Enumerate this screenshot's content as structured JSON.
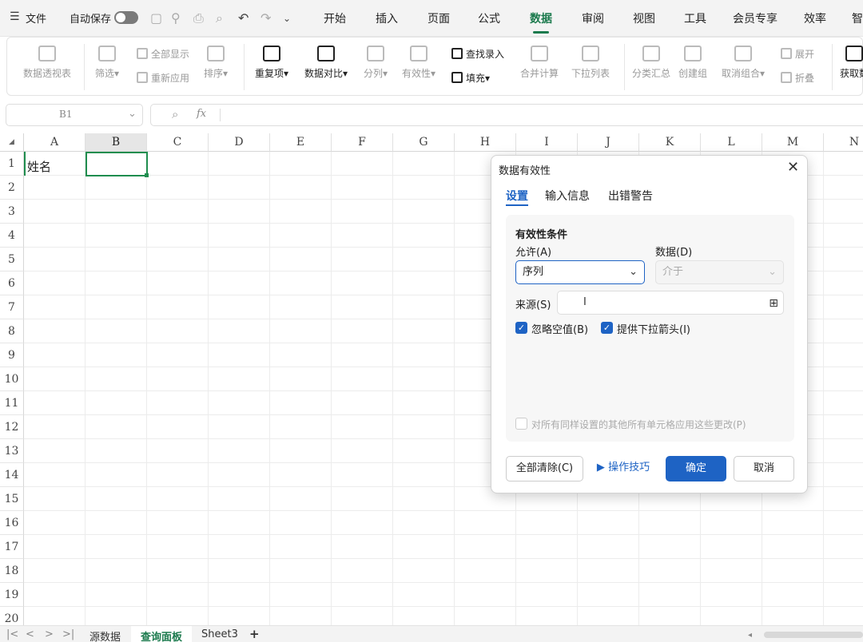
{
  "menubar": {
    "file": "文件",
    "autosave": "自动保存",
    "tabs": [
      "开始",
      "插入",
      "页面",
      "公式",
      "数据",
      "审阅",
      "视图",
      "工具",
      "会员专享",
      "效率",
      "智"
    ]
  },
  "ribbon": {
    "pivot": "数据透视表",
    "filter": "筛选",
    "show_all": "全部显示",
    "reapply": "重新应用",
    "sort": "排序",
    "duplicates": "重复项",
    "compare": "数据对比",
    "split": "分列",
    "validity": "有效性",
    "find_entry": "查找录入",
    "fill": "填充",
    "consolidate": "合并计算",
    "dropdown_list": "下拉列表",
    "subtotal": "分类汇总",
    "create_group": "创建组",
    "ungroup": "取消组合",
    "expand": "展开",
    "collapse": "折叠",
    "get_data": "获取数"
  },
  "formula_bar": {
    "name_box": "B1",
    "fx": "fx"
  },
  "grid": {
    "columns": [
      "A",
      "B",
      "C",
      "D",
      "E",
      "F",
      "G",
      "H",
      "I",
      "J",
      "K",
      "L",
      "M",
      "N"
    ],
    "rows": [
      "1",
      "2",
      "3",
      "4",
      "5",
      "6",
      "7",
      "8",
      "9",
      "10",
      "11",
      "12",
      "13",
      "14",
      "15",
      "16",
      "17",
      "18",
      "19",
      "20"
    ],
    "cell_A1": "姓名",
    "selected_cell": "B1"
  },
  "sheets": {
    "tabs": [
      "源数据",
      "查询面板",
      "Sheet3"
    ],
    "active": "查询面板",
    "add": "+"
  },
  "dialog": {
    "title": "数据有效性",
    "tabs": [
      "设置",
      "输入信息",
      "出错警告"
    ],
    "section_title": "有效性条件",
    "allow_label": "允许(A)",
    "allow_value": "序列",
    "data_label": "数据(D)",
    "data_value": "介于",
    "source_label": "来源(S)",
    "source_value": "",
    "ignore_blank": "忽略空值(B)",
    "dropdown_arrow": "提供下拉箭头(I)",
    "apply_all": "对所有同样设置的其他所有单元格应用这些更改(P)",
    "clear_all": "全部清除(C)",
    "tips": "操作技巧",
    "ok": "确定",
    "cancel": "取消"
  },
  "colors": {
    "accent": "#1b7a4d",
    "primary_button": "#1e63c4",
    "selection": "#1f8d4e"
  }
}
